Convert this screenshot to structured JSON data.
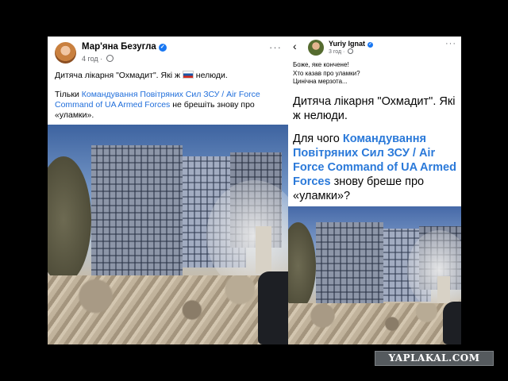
{
  "left_post": {
    "author": "Мар'яна Безугла",
    "time": "4 год",
    "line1_before": "Дитяча лікарня \"Охмадит\". Які ж ",
    "line1_after": " нелюди.",
    "line2_prefix": "Тільки ",
    "line2_link": "Командування Повітряних Сил ЗСУ / Air Force Command of UA Armed Forces",
    "line2_suffix": " не брешіть знову про «уламки».",
    "more_label": "···"
  },
  "right_post": {
    "back_label": "‹",
    "author": "Yuriy Ignat",
    "time": "3 год",
    "caption_line1": "Боже, яке кончене!",
    "caption_line2": "Хто казав про уламки?",
    "caption_line3": "Цинічна мерзота...",
    "quote": "Дитяча лікарня \"Охмадит\". Які ж нелюди.",
    "question_prefix": "Для чого ",
    "question_link": "Командування Повітряних Сил ЗСУ / Air Force Command of UA Armed Forces",
    "question_suffix": " знову бреше про «уламки»?",
    "more_label": "···"
  },
  "watermark": "YAPLAKAL.COM",
  "icons": [
    "verified-badge-icon",
    "globe-icon",
    "more-options-icon",
    "back-arrow-icon",
    "russian-flag-icon"
  ]
}
